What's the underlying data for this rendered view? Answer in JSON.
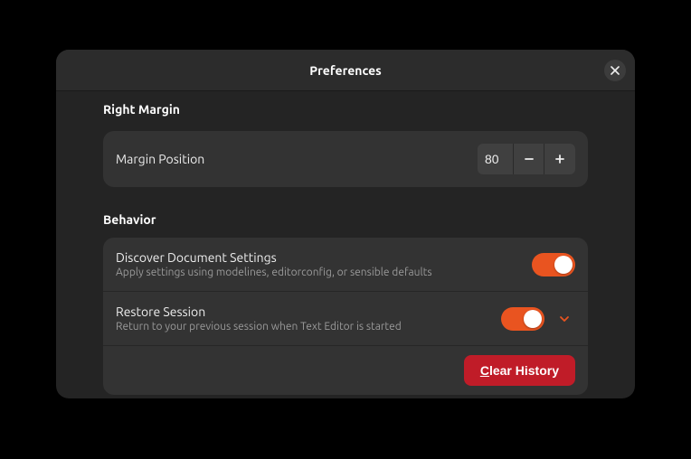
{
  "window": {
    "title": "Preferences"
  },
  "sections": {
    "rightMargin": {
      "heading": "Right Margin",
      "marginPosition": {
        "label": "Margin Position",
        "value": "80"
      }
    },
    "behavior": {
      "heading": "Behavior",
      "discover": {
        "title": "Discover Document Settings",
        "subtitle": "Apply settings using modelines, editorconfig, or sensible defaults",
        "on": true
      },
      "restore": {
        "title": "Restore Session",
        "subtitle": "Return to your previous session when Text Editor is started",
        "on": true
      },
      "clearHistory": {
        "mnemonic": "C",
        "rest": "lear History"
      }
    }
  },
  "colors": {
    "accent": "#e95420",
    "danger": "#c01c28"
  }
}
